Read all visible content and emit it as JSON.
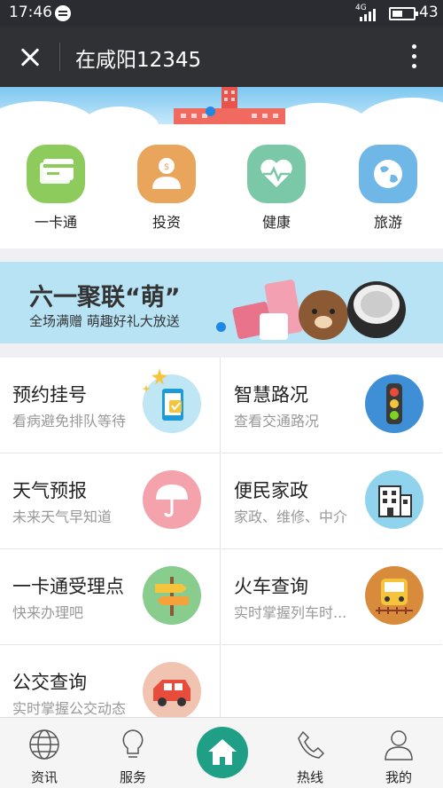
{
  "status_bar": {
    "time": "17:46",
    "network": "4G",
    "battery": "43"
  },
  "header": {
    "title": "在咸阳12345"
  },
  "quick_links": [
    {
      "label": "一卡通",
      "icon": "card-icon",
      "color": "#8dcb5c"
    },
    {
      "label": "投资",
      "icon": "investment-icon",
      "color": "#e8a55b"
    },
    {
      "label": "健康",
      "icon": "heart-icon",
      "color": "#7ac8a7"
    },
    {
      "label": "旅游",
      "icon": "globe-icon",
      "color": "#6fb7e6"
    }
  ],
  "promo": {
    "title": "六一聚联“萌”",
    "subtitle": "全场满赠 萌趣好礼大放送"
  },
  "services": [
    {
      "title": "预约挂号",
      "subtitle": "看病避免排队等待",
      "icon": "appointment-icon",
      "color": "#bfe6f5"
    },
    {
      "title": "智慧路况",
      "subtitle": "查看交通路况",
      "icon": "traffic-light-icon",
      "color": "#3f8fd6"
    },
    {
      "title": "天气预报",
      "subtitle": "未来天气早知道",
      "icon": "umbrella-icon",
      "color": "#f4a3ac"
    },
    {
      "title": "便民家政",
      "subtitle": "家政、维修、中介",
      "icon": "building-icon",
      "color": "#8fd4ec"
    },
    {
      "title": "一卡通受理点",
      "subtitle": "快来办理吧",
      "icon": "signpost-icon",
      "color": "#88cc8e"
    },
    {
      "title": "火车查询",
      "subtitle": "实时掌握列车时...",
      "icon": "train-icon",
      "color": "#d98b3c"
    },
    {
      "title": "公交查询",
      "subtitle": "实时掌握公交动态",
      "icon": "bus-icon",
      "color": "#f1c3b1"
    }
  ],
  "nav": [
    {
      "label": "资讯",
      "icon": "globe-icon"
    },
    {
      "label": "服务",
      "icon": "lightbulb-icon"
    },
    {
      "label": "",
      "icon": "home-icon"
    },
    {
      "label": "热线",
      "icon": "phone-icon"
    },
    {
      "label": "我的",
      "icon": "user-icon"
    }
  ],
  "colors": {
    "accent": "#1fa086",
    "header_bg": "#2f3135",
    "status_bg": "#2a2c31"
  }
}
